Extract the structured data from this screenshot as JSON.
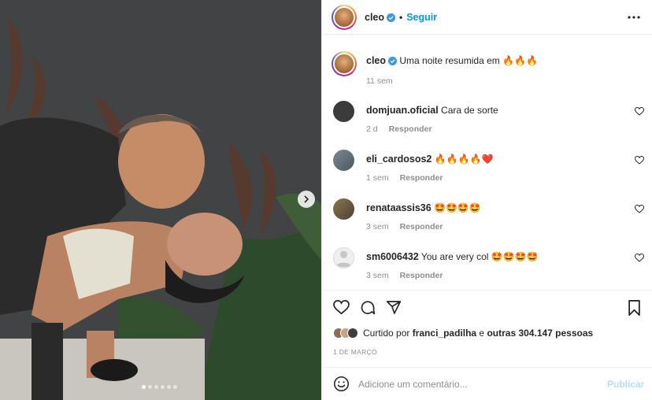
{
  "post": {
    "carousel": {
      "slide_count": 6,
      "active_slide": 1
    },
    "next_icon": "chevron-right-icon"
  },
  "header": {
    "username": "cleo",
    "separator": "•",
    "follow_label": "Seguir",
    "verified_icon": "verified-badge-icon",
    "more_icon": "more-horizontal-icon"
  },
  "caption": {
    "username": "cleo",
    "text": "Uma noite resumida em",
    "emojis": "🔥🔥🔥",
    "time": "11 sem"
  },
  "comments": [
    {
      "username": "domjuan.oficial",
      "text": "Cara de sorte",
      "emojis": "",
      "time": "2 d",
      "reply_label": "Responder",
      "avatar_color": "#3b3b3b"
    },
    {
      "username": "eli_cardosos2",
      "text": "",
      "emojis": "🔥🔥🔥🔥❤️",
      "time": "1 sem",
      "reply_label": "Responder",
      "avatar_color": "#5d6b7a"
    },
    {
      "username": "renataassis36",
      "text": "",
      "emojis": "🤩🤩🤩🤩",
      "time": "3 sem",
      "reply_label": "Responder",
      "avatar_color": "#6b5a3e"
    },
    {
      "username": "sm6006432",
      "text": "You are very col",
      "emojis": "🤩🤩🤩🤩",
      "time": "3 sem",
      "reply_label": "Responder",
      "avatar_color": "#dbdbdb"
    }
  ],
  "actions": {
    "like_icon": "heart-icon",
    "comment_icon": "comment-icon",
    "share_icon": "send-icon",
    "save_icon": "bookmark-icon"
  },
  "likes": {
    "prefix": "Curtido por",
    "user": "franci_padilha",
    "connector": "e",
    "others": "outras 304.147 pessoas"
  },
  "date": "1 DE MARÇO",
  "composer": {
    "emoji_icon": "smiley-icon",
    "placeholder": "Adicione um comentário...",
    "publish_label": "Publicar"
  },
  "colors": {
    "accent": "#0095f6",
    "publish_disabled": "#b2dffc",
    "muted": "#8e8e8e",
    "text": "#262626",
    "verified": "#3897f0"
  }
}
